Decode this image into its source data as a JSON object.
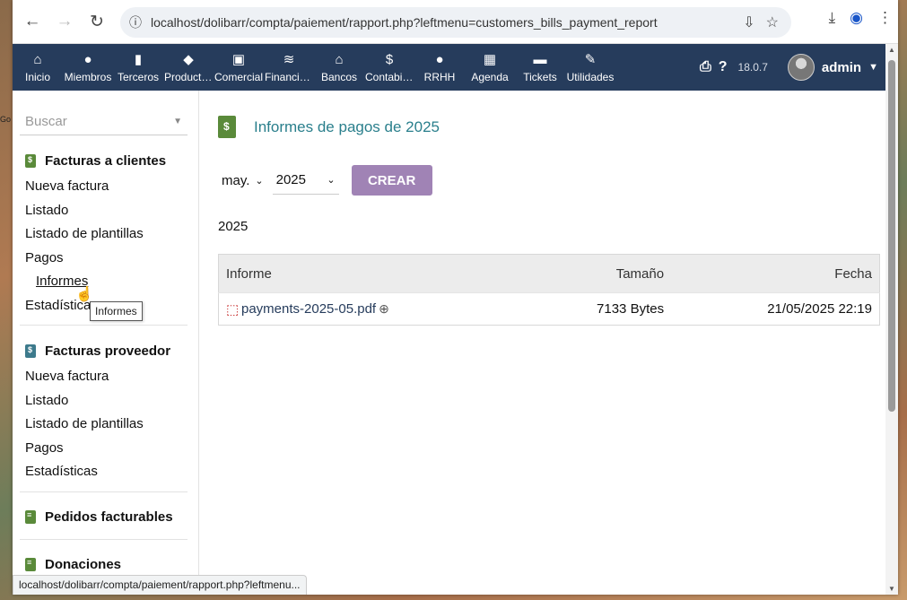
{
  "browser": {
    "url": "localhost/dolibarr/compta/paiement/rapport.php?leftmenu=customers_bills_payment_report",
    "status_url": "localhost/dolibarr/compta/paiement/rapport.php?leftmenu..."
  },
  "topmenu": [
    {
      "label": "Inicio",
      "icon": "home-icon",
      "glyph": "⌂"
    },
    {
      "label": "Miembros",
      "icon": "member-icon",
      "glyph": "●"
    },
    {
      "label": "Terceros",
      "icon": "building-icon",
      "glyph": "▮"
    },
    {
      "label": "Productos",
      "icon": "cube-icon",
      "glyph": "◆"
    },
    {
      "label": "Comercial",
      "icon": "briefcase-icon",
      "glyph": "▣"
    },
    {
      "label": "Financiera",
      "icon": "coins-icon",
      "glyph": "≋"
    },
    {
      "label": "Bancos",
      "icon": "bank-icon",
      "glyph": "⌂"
    },
    {
      "label": "Contabilidad",
      "icon": "dollar-search-icon",
      "glyph": "$"
    },
    {
      "label": "RRHH",
      "icon": "user-tie-icon",
      "glyph": "●"
    },
    {
      "label": "Agenda",
      "icon": "calendar-icon",
      "glyph": "▦"
    },
    {
      "label": "Tickets",
      "icon": "ticket-icon",
      "glyph": "▬"
    },
    {
      "label": "Utilidades",
      "icon": "wrench-icon",
      "glyph": "✎"
    }
  ],
  "topbar": {
    "version": "18.0.7",
    "user": "admin"
  },
  "sidebar": {
    "search_placeholder": "Buscar",
    "sections": [
      {
        "title": "Facturas a clientes",
        "items": [
          "Nueva factura",
          "Listado",
          "Listado de plantillas",
          "Pagos",
          "Informes",
          "Estadísticas"
        ]
      },
      {
        "title": "Facturas proveedor",
        "items": [
          "Nueva factura",
          "Listado",
          "Listado de plantillas",
          "Pagos",
          "Estadísticas"
        ]
      },
      {
        "title": "Pedidos facturables"
      },
      {
        "title": "Donaciones"
      }
    ],
    "tooltip": "Informes"
  },
  "main": {
    "title": "Informes de pagos de 2025",
    "month": "may.",
    "year": "2025",
    "create_label": "CREAR",
    "year_heading": "2025",
    "table": {
      "headers": [
        "Informe",
        "Tamaño",
        "Fecha"
      ],
      "rows": [
        {
          "file": "payments-2025-05.pdf",
          "size": "7133 Bytes",
          "date": "21/05/2025 22:19"
        }
      ]
    }
  }
}
